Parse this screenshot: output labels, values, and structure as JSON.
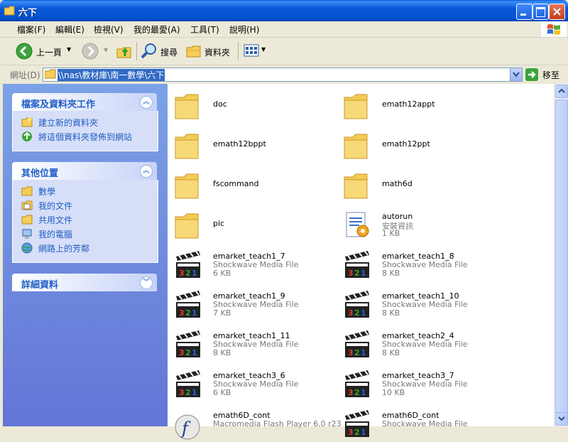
{
  "window": {
    "title": "六下"
  },
  "menu": {
    "items": [
      "檔案(F)",
      "編輯(E)",
      "檢視(V)",
      "我的最愛(A)",
      "工具(T)",
      "說明(H)"
    ]
  },
  "toolbar": {
    "back_label": "上一頁",
    "search_label": "搜尋",
    "folders_label": "資料夾"
  },
  "address": {
    "label": "網址(D)",
    "path": "\\\\nas\\教材庫\\南一數學\\六下",
    "go_label": "移至"
  },
  "tasks_panel": {
    "title": "檔案及資料夾工作",
    "items": [
      {
        "label": "建立新的資料夾",
        "icon": "new-folder-icon"
      },
      {
        "label": "將這個資料夾發佈到網站",
        "icon": "publish-web-icon"
      }
    ]
  },
  "places_panel": {
    "title": "其他位置",
    "items": [
      {
        "label": "數學",
        "icon": "folder-icon"
      },
      {
        "label": "我的文件",
        "icon": "my-documents-icon"
      },
      {
        "label": "共用文件",
        "icon": "shared-documents-icon"
      },
      {
        "label": "我的電腦",
        "icon": "my-computer-icon"
      },
      {
        "label": "網路上的芳鄰",
        "icon": "network-places-icon"
      }
    ]
  },
  "details_panel": {
    "title": "詳細資料"
  },
  "files": [
    {
      "name": "doc",
      "kind": "folder"
    },
    {
      "name": "emath12appt",
      "kind": "folder"
    },
    {
      "name": "emath12bppt",
      "kind": "folder"
    },
    {
      "name": "emath12ppt",
      "kind": "folder"
    },
    {
      "name": "fscommand",
      "kind": "folder"
    },
    {
      "name": "math6d",
      "kind": "folder"
    },
    {
      "name": "pic",
      "kind": "folder"
    },
    {
      "name": "autorun",
      "kind": "setup",
      "type": "安裝資訊",
      "size": "1 KB"
    },
    {
      "name": "emarket_teach1_7",
      "kind": "swf",
      "type": "Shockwave Media File",
      "size": "6 KB"
    },
    {
      "name": "emarket_teach1_8",
      "kind": "swf",
      "type": "Shockwave Media File",
      "size": "8 KB"
    },
    {
      "name": "emarket_teach1_9",
      "kind": "swf",
      "type": "Shockwave Media File",
      "size": "7 KB"
    },
    {
      "name": "emarket_teach1_10",
      "kind": "swf",
      "type": "Shockwave Media File",
      "size": "8 KB"
    },
    {
      "name": "emarket_teach1_11",
      "kind": "swf",
      "type": "Shockwave Media File",
      "size": "8 KB"
    },
    {
      "name": "emarket_teach2_4",
      "kind": "swf",
      "type": "Shockwave Media File",
      "size": "8 KB"
    },
    {
      "name": "emarket_teach3_6",
      "kind": "swf",
      "type": "Shockwave Media File",
      "size": "6 KB"
    },
    {
      "name": "emarket_teach3_7",
      "kind": "swf",
      "type": "Shockwave Media File",
      "size": "10 KB"
    },
    {
      "name": "emath6D_cont",
      "kind": "flashplayer",
      "type": "Macromedia Flash Player 6.0 r23",
      "size": ""
    },
    {
      "name": "emath6D_cont",
      "kind": "swf",
      "type": "Shockwave Media File",
      "size": ""
    }
  ]
}
